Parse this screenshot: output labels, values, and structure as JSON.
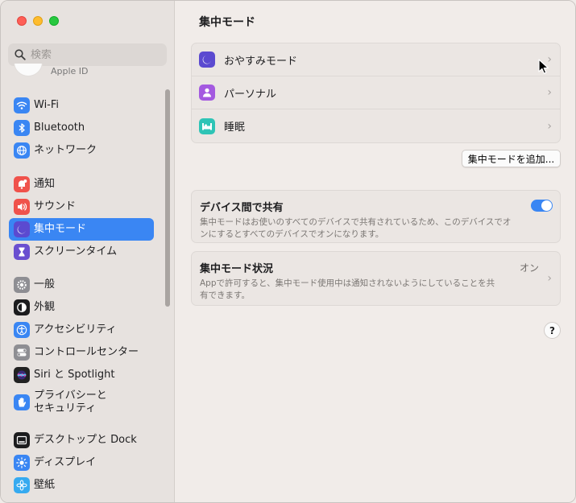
{
  "sidebar": {
    "search_placeholder": "検索",
    "apple_id_label": "Apple ID",
    "groups": [
      [
        {
          "label": "Wi-Fi",
          "icon": "wifi-icon",
          "color": "#3a86f3"
        },
        {
          "label": "Bluetooth",
          "icon": "bluetooth-icon",
          "color": "#3a86f3"
        },
        {
          "label": "ネットワーク",
          "icon": "globe-icon",
          "color": "#3a86f3"
        }
      ],
      [
        {
          "label": "通知",
          "icon": "bell-icon",
          "color": "#f0524b"
        },
        {
          "label": "サウンド",
          "icon": "speaker-icon",
          "color": "#f0524b"
        },
        {
          "label": "集中モード",
          "icon": "moon-icon",
          "color": "#5b4ad0",
          "selected": true
        },
        {
          "label": "スクリーンタイム",
          "icon": "hourglass-icon",
          "color": "#6a4fd0"
        }
      ],
      [
        {
          "label": "一般",
          "icon": "gear-icon",
          "color": "#8e8e93"
        },
        {
          "label": "外観",
          "icon": "appearance-icon",
          "color": "#1c1c1e"
        },
        {
          "label": "アクセシビリティ",
          "icon": "accessibility-icon",
          "color": "#3a86f3"
        },
        {
          "label": "コントロールセンター",
          "icon": "control-center-icon",
          "color": "#8e8e93"
        },
        {
          "label": "Siri と Spotlight",
          "icon": "siri-icon",
          "color": "#222"
        },
        {
          "label": "プライバシーと\nセキュリティ",
          "icon": "hand-icon",
          "color": "#3a86f3",
          "tall": true
        }
      ],
      [
        {
          "label": "デスクトップと Dock",
          "icon": "dock-icon",
          "color": "#1c1c1e"
        },
        {
          "label": "ディスプレイ",
          "icon": "sun-icon",
          "color": "#3a86f3"
        },
        {
          "label": "壁紙",
          "icon": "flower-icon",
          "color": "#36aaf0"
        }
      ]
    ]
  },
  "main": {
    "title": "集中モード",
    "focus_modes": [
      {
        "label": "おやすみモード",
        "icon": "moon-icon",
        "color": "#5b4ad0"
      },
      {
        "label": "パーソナル",
        "icon": "person-icon",
        "color": "#a45ae0"
      },
      {
        "label": "睡眠",
        "icon": "bed-icon",
        "color": "#2ec4b6"
      }
    ],
    "add_button": "集中モードを追加...",
    "share": {
      "title": "デバイス間で共有",
      "description": "集中モードはお使いのすべてのデバイスで共有されているため、このデバイスでオンにするとすべてのデバイスでオンになります。",
      "enabled": true
    },
    "status": {
      "title": "集中モード状況",
      "value": "オン",
      "description": "Appで許可すると、集中モード使用中は通知されないようにしていることを共有できます。"
    },
    "help_label": "?"
  }
}
